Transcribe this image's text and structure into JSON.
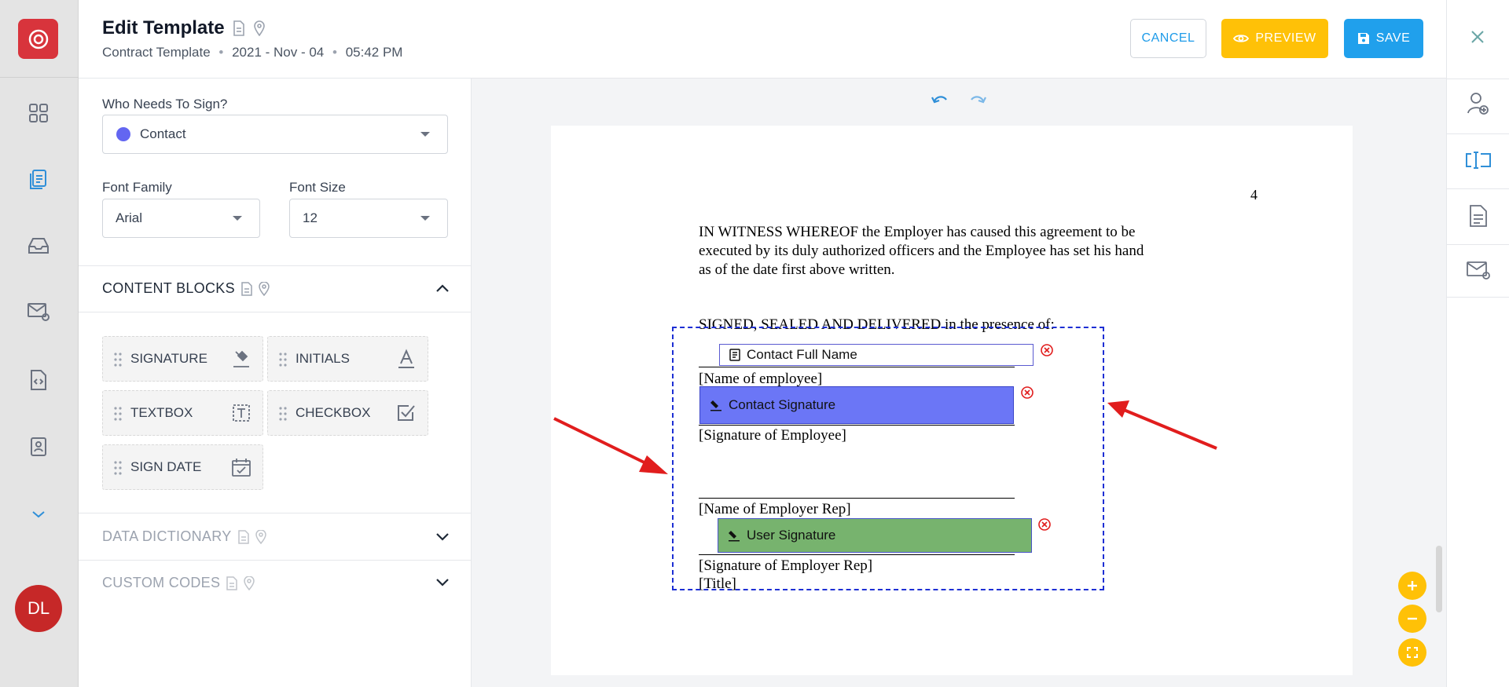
{
  "header": {
    "title": "Edit Template",
    "subtitle_type": "Contract Template",
    "subtitle_date": "2021 - Nov - 04",
    "subtitle_time": "05:42 PM",
    "cancel_label": "CANCEL",
    "preview_label": "PREVIEW",
    "save_label": "SAVE"
  },
  "rail": {
    "avatar_initials": "DL",
    "items": [
      "dashboard-icon",
      "documents-icon",
      "inbox-icon",
      "mail-settings-icon",
      "code-icon",
      "contacts-icon",
      "chevron-down-icon"
    ]
  },
  "right_rail": {
    "items": [
      "add-recipient-icon",
      "text-field-icon",
      "document-icon",
      "email-settings-icon"
    ]
  },
  "panel": {
    "who_label": "Who Needs To Sign?",
    "who_value": "Contact",
    "who_color": "#6366f1",
    "font_family_label": "Font Family",
    "font_family_value": "Arial",
    "font_size_label": "Font Size",
    "font_size_value": "12",
    "content_blocks_title": "CONTENT BLOCKS",
    "blocks": [
      {
        "label": "SIGNATURE",
        "icon": "signature-pen-icon"
      },
      {
        "label": "INITIALS",
        "icon": "initials-icon"
      },
      {
        "label": "TEXTBOX",
        "icon": "textbox-icon"
      },
      {
        "label": "CHECKBOX",
        "icon": "checkbox-icon"
      },
      {
        "label": "SIGN DATE",
        "icon": "calendar-icon"
      }
    ],
    "data_dictionary_title": "DATA DICTIONARY",
    "custom_codes_title": "CUSTOM CODES"
  },
  "document": {
    "page_number": "4",
    "para_line1": "IN WITNESS WHEREOF the Employer has caused this agreement to be",
    "para_line2": "executed by its duly authorized officers and the Employee has set his hand",
    "para_line3": "as of the date first above written.",
    "signed_line": "SIGNED, SEALED AND DELIVERED in the presence of:",
    "name_employee": "[Name of employee]",
    "signature_employee": "[Signature of Employee]",
    "name_employer_rep": "[Name of Employer Rep]",
    "signature_employer_rep": "[Signature of Employer Rep]",
    "title": "[Title]"
  },
  "fields": {
    "contact_full_name": "Contact Full Name",
    "contact_signature": "Contact Signature",
    "user_signature": "User Signature",
    "contact_signature_color": "#6b76f6",
    "user_signature_color": "#77b36e"
  },
  "colors": {
    "brand": "#d8343c",
    "accent_blue": "#20a0ec",
    "accent_yellow": "#ffc107",
    "annotation_arrow": "#e11d1d"
  }
}
